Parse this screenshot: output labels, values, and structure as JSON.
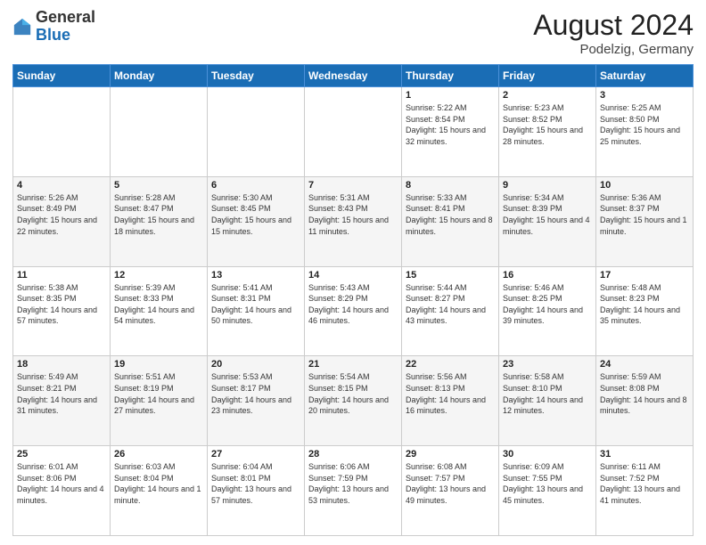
{
  "header": {
    "logo_general": "General",
    "logo_blue": "Blue",
    "month_title": "August 2024",
    "subtitle": "Podelzig, Germany"
  },
  "weekdays": [
    "Sunday",
    "Monday",
    "Tuesday",
    "Wednesday",
    "Thursday",
    "Friday",
    "Saturday"
  ],
  "weeks": [
    [
      {
        "day": "",
        "sunrise": "",
        "sunset": "",
        "daylight": ""
      },
      {
        "day": "",
        "sunrise": "",
        "sunset": "",
        "daylight": ""
      },
      {
        "day": "",
        "sunrise": "",
        "sunset": "",
        "daylight": ""
      },
      {
        "day": "",
        "sunrise": "",
        "sunset": "",
        "daylight": ""
      },
      {
        "day": "1",
        "sunrise": "Sunrise: 5:22 AM",
        "sunset": "Sunset: 8:54 PM",
        "daylight": "Daylight: 15 hours and 32 minutes."
      },
      {
        "day": "2",
        "sunrise": "Sunrise: 5:23 AM",
        "sunset": "Sunset: 8:52 PM",
        "daylight": "Daylight: 15 hours and 28 minutes."
      },
      {
        "day": "3",
        "sunrise": "Sunrise: 5:25 AM",
        "sunset": "Sunset: 8:50 PM",
        "daylight": "Daylight: 15 hours and 25 minutes."
      }
    ],
    [
      {
        "day": "4",
        "sunrise": "Sunrise: 5:26 AM",
        "sunset": "Sunset: 8:49 PM",
        "daylight": "Daylight: 15 hours and 22 minutes."
      },
      {
        "day": "5",
        "sunrise": "Sunrise: 5:28 AM",
        "sunset": "Sunset: 8:47 PM",
        "daylight": "Daylight: 15 hours and 18 minutes."
      },
      {
        "day": "6",
        "sunrise": "Sunrise: 5:30 AM",
        "sunset": "Sunset: 8:45 PM",
        "daylight": "Daylight: 15 hours and 15 minutes."
      },
      {
        "day": "7",
        "sunrise": "Sunrise: 5:31 AM",
        "sunset": "Sunset: 8:43 PM",
        "daylight": "Daylight: 15 hours and 11 minutes."
      },
      {
        "day": "8",
        "sunrise": "Sunrise: 5:33 AM",
        "sunset": "Sunset: 8:41 PM",
        "daylight": "Daylight: 15 hours and 8 minutes."
      },
      {
        "day": "9",
        "sunrise": "Sunrise: 5:34 AM",
        "sunset": "Sunset: 8:39 PM",
        "daylight": "Daylight: 15 hours and 4 minutes."
      },
      {
        "day": "10",
        "sunrise": "Sunrise: 5:36 AM",
        "sunset": "Sunset: 8:37 PM",
        "daylight": "Daylight: 15 hours and 1 minute."
      }
    ],
    [
      {
        "day": "11",
        "sunrise": "Sunrise: 5:38 AM",
        "sunset": "Sunset: 8:35 PM",
        "daylight": "Daylight: 14 hours and 57 minutes."
      },
      {
        "day": "12",
        "sunrise": "Sunrise: 5:39 AM",
        "sunset": "Sunset: 8:33 PM",
        "daylight": "Daylight: 14 hours and 54 minutes."
      },
      {
        "day": "13",
        "sunrise": "Sunrise: 5:41 AM",
        "sunset": "Sunset: 8:31 PM",
        "daylight": "Daylight: 14 hours and 50 minutes."
      },
      {
        "day": "14",
        "sunrise": "Sunrise: 5:43 AM",
        "sunset": "Sunset: 8:29 PM",
        "daylight": "Daylight: 14 hours and 46 minutes."
      },
      {
        "day": "15",
        "sunrise": "Sunrise: 5:44 AM",
        "sunset": "Sunset: 8:27 PM",
        "daylight": "Daylight: 14 hours and 43 minutes."
      },
      {
        "day": "16",
        "sunrise": "Sunrise: 5:46 AM",
        "sunset": "Sunset: 8:25 PM",
        "daylight": "Daylight: 14 hours and 39 minutes."
      },
      {
        "day": "17",
        "sunrise": "Sunrise: 5:48 AM",
        "sunset": "Sunset: 8:23 PM",
        "daylight": "Daylight: 14 hours and 35 minutes."
      }
    ],
    [
      {
        "day": "18",
        "sunrise": "Sunrise: 5:49 AM",
        "sunset": "Sunset: 8:21 PM",
        "daylight": "Daylight: 14 hours and 31 minutes."
      },
      {
        "day": "19",
        "sunrise": "Sunrise: 5:51 AM",
        "sunset": "Sunset: 8:19 PM",
        "daylight": "Daylight: 14 hours and 27 minutes."
      },
      {
        "day": "20",
        "sunrise": "Sunrise: 5:53 AM",
        "sunset": "Sunset: 8:17 PM",
        "daylight": "Daylight: 14 hours and 23 minutes."
      },
      {
        "day": "21",
        "sunrise": "Sunrise: 5:54 AM",
        "sunset": "Sunset: 8:15 PM",
        "daylight": "Daylight: 14 hours and 20 minutes."
      },
      {
        "day": "22",
        "sunrise": "Sunrise: 5:56 AM",
        "sunset": "Sunset: 8:13 PM",
        "daylight": "Daylight: 14 hours and 16 minutes."
      },
      {
        "day": "23",
        "sunrise": "Sunrise: 5:58 AM",
        "sunset": "Sunset: 8:10 PM",
        "daylight": "Daylight: 14 hours and 12 minutes."
      },
      {
        "day": "24",
        "sunrise": "Sunrise: 5:59 AM",
        "sunset": "Sunset: 8:08 PM",
        "daylight": "Daylight: 14 hours and 8 minutes."
      }
    ],
    [
      {
        "day": "25",
        "sunrise": "Sunrise: 6:01 AM",
        "sunset": "Sunset: 8:06 PM",
        "daylight": "Daylight: 14 hours and 4 minutes."
      },
      {
        "day": "26",
        "sunrise": "Sunrise: 6:03 AM",
        "sunset": "Sunset: 8:04 PM",
        "daylight": "Daylight: 14 hours and 1 minute."
      },
      {
        "day": "27",
        "sunrise": "Sunrise: 6:04 AM",
        "sunset": "Sunset: 8:01 PM",
        "daylight": "Daylight: 13 hours and 57 minutes."
      },
      {
        "day": "28",
        "sunrise": "Sunrise: 6:06 AM",
        "sunset": "Sunset: 7:59 PM",
        "daylight": "Daylight: 13 hours and 53 minutes."
      },
      {
        "day": "29",
        "sunrise": "Sunrise: 6:08 AM",
        "sunset": "Sunset: 7:57 PM",
        "daylight": "Daylight: 13 hours and 49 minutes."
      },
      {
        "day": "30",
        "sunrise": "Sunrise: 6:09 AM",
        "sunset": "Sunset: 7:55 PM",
        "daylight": "Daylight: 13 hours and 45 minutes."
      },
      {
        "day": "31",
        "sunrise": "Sunrise: 6:11 AM",
        "sunset": "Sunset: 7:52 PM",
        "daylight": "Daylight: 13 hours and 41 minutes."
      }
    ]
  ]
}
